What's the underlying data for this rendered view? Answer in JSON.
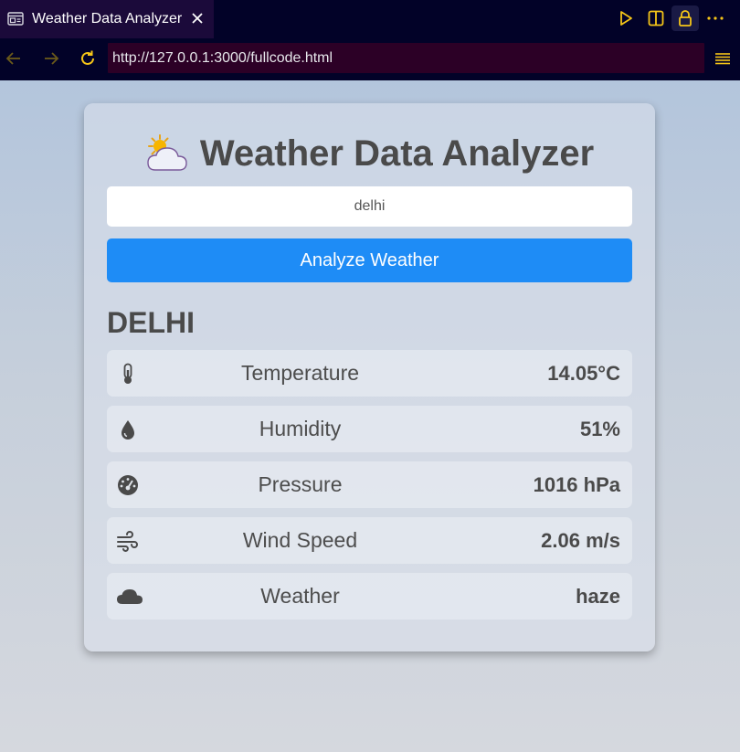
{
  "browser": {
    "tab_title": "Weather Data Analyzer",
    "url": "http://127.0.0.1:3000/fullcode.html",
    "icons": {
      "tab": "webpage-icon",
      "close": "close-icon",
      "run": "play-icon",
      "split": "split-view-icon",
      "lock": "lock-icon",
      "more": "more-icon",
      "back": "back-arrow-icon",
      "forward": "forward-arrow-icon",
      "reload": "reload-icon",
      "menu": "hamburger-menu-icon"
    },
    "colors": {
      "chrome": "#020228",
      "url_box": "#2c0026",
      "accent": "#f5c518"
    }
  },
  "app": {
    "title": "Weather Data Analyzer",
    "title_icon": "sun-behind-cloud-icon",
    "input_value": "delhi",
    "button_label": "Analyze Weather",
    "button_color": "#1e8cf6"
  },
  "result": {
    "city": "DELHI",
    "rows": [
      {
        "icon": "thermometer-icon",
        "label": "Temperature",
        "value": "14.05°C"
      },
      {
        "icon": "droplet-icon",
        "label": "Humidity",
        "value": "51%"
      },
      {
        "icon": "gauge-icon",
        "label": "Pressure",
        "value": "1016 hPa"
      },
      {
        "icon": "wind-icon",
        "label": "Wind Speed",
        "value": "2.06 m/s"
      },
      {
        "icon": "cloud-icon",
        "label": "Weather",
        "value": "haze"
      }
    ]
  }
}
